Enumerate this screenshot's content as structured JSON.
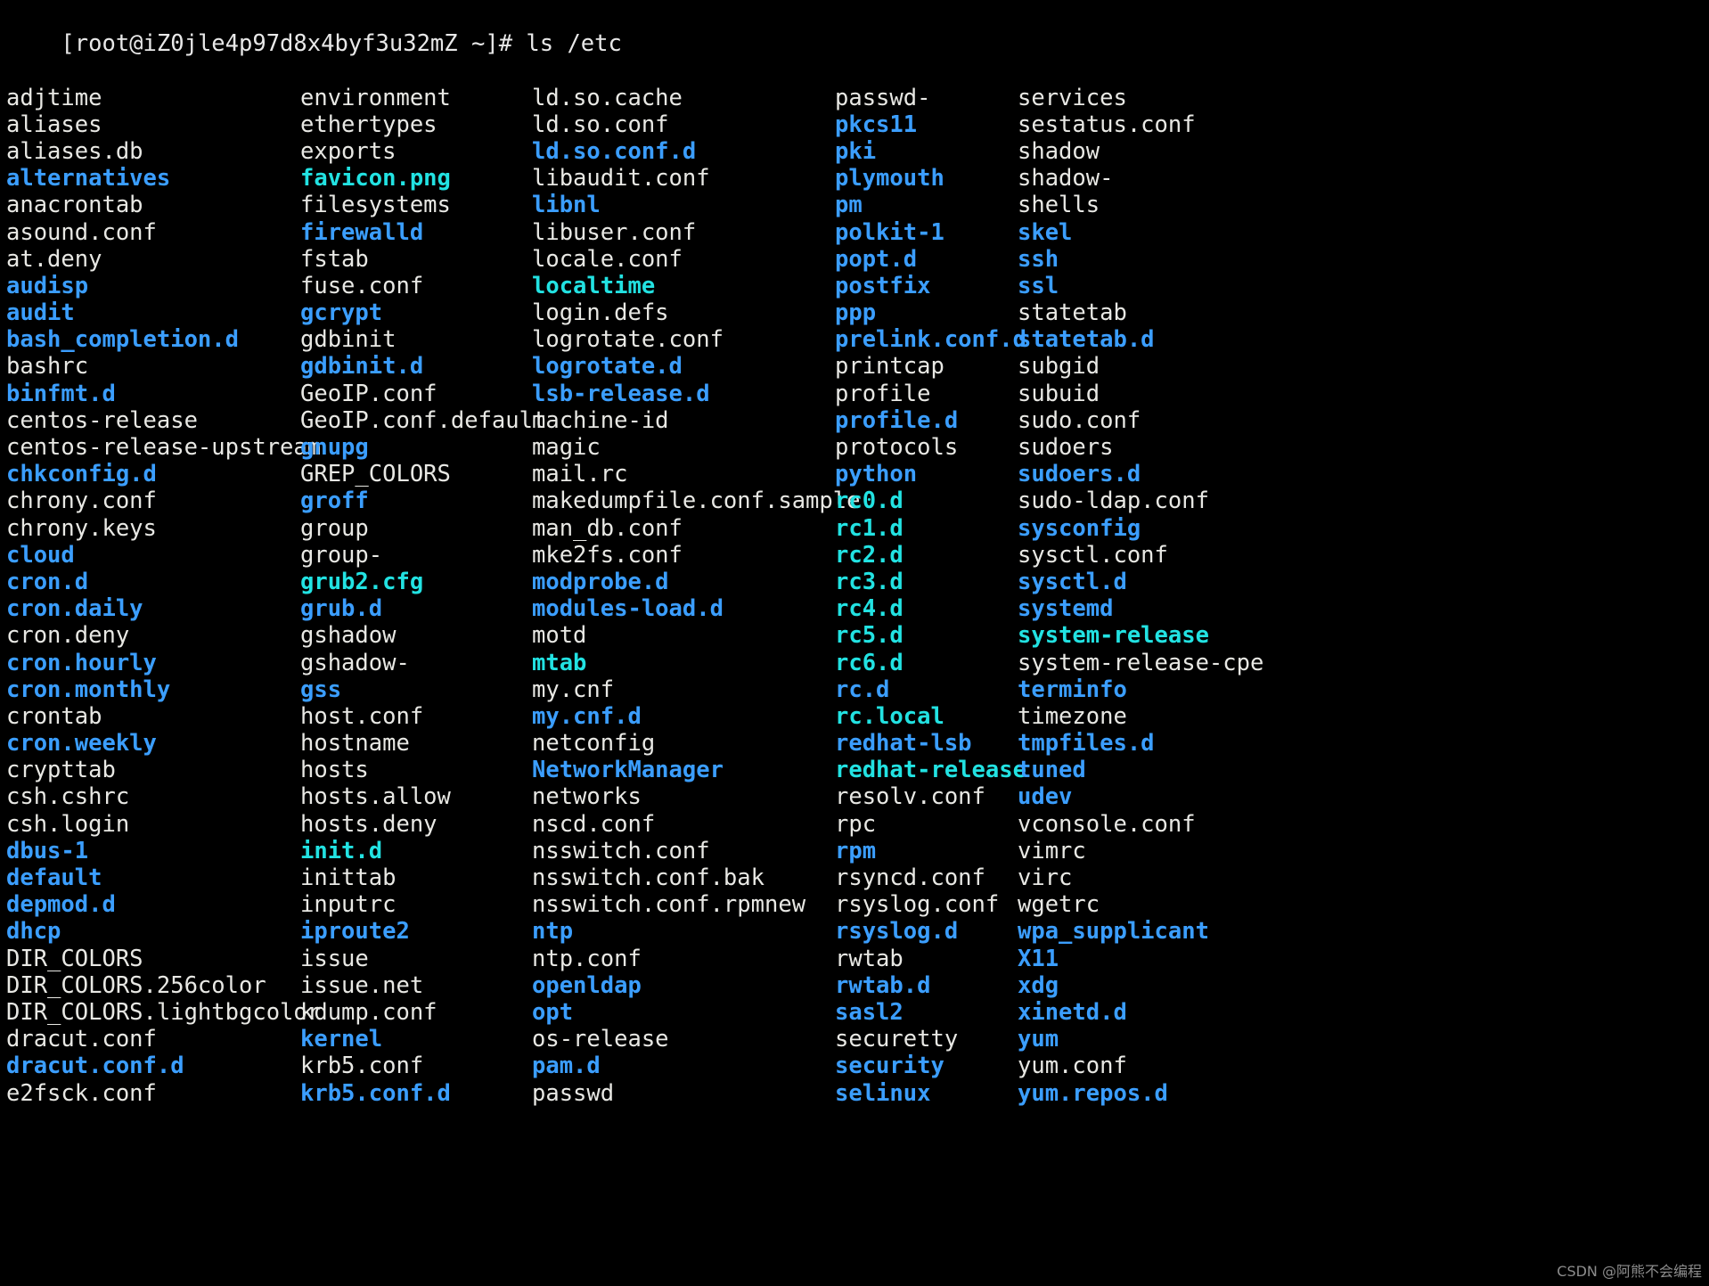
{
  "terminal": {
    "prompt": "[root@iZ0jle4p97d8x4byf3u32mZ ~]# ls /etc",
    "colors": {
      "background": "#000000",
      "file": "#e8e8e4",
      "directory": "#3b9eff",
      "symlink": "#22e2e2",
      "image": "#22e2e2"
    },
    "columns": [
      {
        "name": "column-1",
        "entries": [
          {
            "name": "adjtime",
            "type": "file"
          },
          {
            "name": "aliases",
            "type": "file"
          },
          {
            "name": "aliases.db",
            "type": "file"
          },
          {
            "name": "alternatives",
            "type": "directory"
          },
          {
            "name": "anacrontab",
            "type": "file"
          },
          {
            "name": "asound.conf",
            "type": "file"
          },
          {
            "name": "at.deny",
            "type": "file"
          },
          {
            "name": "audisp",
            "type": "directory"
          },
          {
            "name": "audit",
            "type": "directory"
          },
          {
            "name": "bash_completion.d",
            "type": "directory"
          },
          {
            "name": "bashrc",
            "type": "file"
          },
          {
            "name": "binfmt.d",
            "type": "directory"
          },
          {
            "name": "centos-release",
            "type": "file"
          },
          {
            "name": "centos-release-upstream",
            "type": "file"
          },
          {
            "name": "chkconfig.d",
            "type": "directory"
          },
          {
            "name": "chrony.conf",
            "type": "file"
          },
          {
            "name": "chrony.keys",
            "type": "file"
          },
          {
            "name": "cloud",
            "type": "directory"
          },
          {
            "name": "cron.d",
            "type": "directory"
          },
          {
            "name": "cron.daily",
            "type": "directory"
          },
          {
            "name": "cron.deny",
            "type": "file"
          },
          {
            "name": "cron.hourly",
            "type": "directory"
          },
          {
            "name": "cron.monthly",
            "type": "directory"
          },
          {
            "name": "crontab",
            "type": "file"
          },
          {
            "name": "cron.weekly",
            "type": "directory"
          },
          {
            "name": "crypttab",
            "type": "file"
          },
          {
            "name": "csh.cshrc",
            "type": "file"
          },
          {
            "name": "csh.login",
            "type": "file"
          },
          {
            "name": "dbus-1",
            "type": "directory"
          },
          {
            "name": "default",
            "type": "directory"
          },
          {
            "name": "depmod.d",
            "type": "directory"
          },
          {
            "name": "dhcp",
            "type": "directory"
          },
          {
            "name": "DIR_COLORS",
            "type": "file"
          },
          {
            "name": "DIR_COLORS.256color",
            "type": "file"
          },
          {
            "name": "DIR_COLORS.lightbgcolor",
            "type": "file"
          },
          {
            "name": "dracut.conf",
            "type": "file"
          },
          {
            "name": "dracut.conf.d",
            "type": "directory"
          },
          {
            "name": "e2fsck.conf",
            "type": "file"
          }
        ]
      },
      {
        "name": "column-2",
        "entries": [
          {
            "name": "environment",
            "type": "file"
          },
          {
            "name": "ethertypes",
            "type": "file"
          },
          {
            "name": "exports",
            "type": "file"
          },
          {
            "name": "favicon.png",
            "type": "image"
          },
          {
            "name": "filesystems",
            "type": "file"
          },
          {
            "name": "firewalld",
            "type": "directory"
          },
          {
            "name": "fstab",
            "type": "file"
          },
          {
            "name": "fuse.conf",
            "type": "file"
          },
          {
            "name": "gcrypt",
            "type": "directory"
          },
          {
            "name": "gdbinit",
            "type": "file"
          },
          {
            "name": "gdbinit.d",
            "type": "directory"
          },
          {
            "name": "GeoIP.conf",
            "type": "file"
          },
          {
            "name": "GeoIP.conf.default",
            "type": "file"
          },
          {
            "name": "gnupg",
            "type": "directory"
          },
          {
            "name": "GREP_COLORS",
            "type": "file"
          },
          {
            "name": "groff",
            "type": "directory"
          },
          {
            "name": "group",
            "type": "file"
          },
          {
            "name": "group-",
            "type": "file"
          },
          {
            "name": "grub2.cfg",
            "type": "symlink"
          },
          {
            "name": "grub.d",
            "type": "directory"
          },
          {
            "name": "gshadow",
            "type": "file"
          },
          {
            "name": "gshadow-",
            "type": "file"
          },
          {
            "name": "gss",
            "type": "directory"
          },
          {
            "name": "host.conf",
            "type": "file"
          },
          {
            "name": "hostname",
            "type": "file"
          },
          {
            "name": "hosts",
            "type": "file"
          },
          {
            "name": "hosts.allow",
            "type": "file"
          },
          {
            "name": "hosts.deny",
            "type": "file"
          },
          {
            "name": "init.d",
            "type": "symlink"
          },
          {
            "name": "inittab",
            "type": "file"
          },
          {
            "name": "inputrc",
            "type": "file"
          },
          {
            "name": "iproute2",
            "type": "directory"
          },
          {
            "name": "issue",
            "type": "file"
          },
          {
            "name": "issue.net",
            "type": "file"
          },
          {
            "name": "kdump.conf",
            "type": "file"
          },
          {
            "name": "kernel",
            "type": "directory"
          },
          {
            "name": "krb5.conf",
            "type": "file"
          },
          {
            "name": "krb5.conf.d",
            "type": "directory"
          }
        ]
      },
      {
        "name": "column-3",
        "entries": [
          {
            "name": "ld.so.cache",
            "type": "file"
          },
          {
            "name": "ld.so.conf",
            "type": "file"
          },
          {
            "name": "ld.so.conf.d",
            "type": "directory"
          },
          {
            "name": "libaudit.conf",
            "type": "file"
          },
          {
            "name": "libnl",
            "type": "directory"
          },
          {
            "name": "libuser.conf",
            "type": "file"
          },
          {
            "name": "locale.conf",
            "type": "file"
          },
          {
            "name": "localtime",
            "type": "symlink"
          },
          {
            "name": "login.defs",
            "type": "file"
          },
          {
            "name": "logrotate.conf",
            "type": "file"
          },
          {
            "name": "logrotate.d",
            "type": "directory"
          },
          {
            "name": "lsb-release.d",
            "type": "directory"
          },
          {
            "name": "machine-id",
            "type": "file"
          },
          {
            "name": "magic",
            "type": "file"
          },
          {
            "name": "mail.rc",
            "type": "file"
          },
          {
            "name": "makedumpfile.conf.sample",
            "type": "file"
          },
          {
            "name": "man_db.conf",
            "type": "file"
          },
          {
            "name": "mke2fs.conf",
            "type": "file"
          },
          {
            "name": "modprobe.d",
            "type": "directory"
          },
          {
            "name": "modules-load.d",
            "type": "directory"
          },
          {
            "name": "motd",
            "type": "file"
          },
          {
            "name": "mtab",
            "type": "symlink"
          },
          {
            "name": "my.cnf",
            "type": "file"
          },
          {
            "name": "my.cnf.d",
            "type": "directory"
          },
          {
            "name": "netconfig",
            "type": "file"
          },
          {
            "name": "NetworkManager",
            "type": "directory"
          },
          {
            "name": "networks",
            "type": "file"
          },
          {
            "name": "nscd.conf",
            "type": "file"
          },
          {
            "name": "nsswitch.conf",
            "type": "file"
          },
          {
            "name": "nsswitch.conf.bak",
            "type": "file"
          },
          {
            "name": "nsswitch.conf.rpmnew",
            "type": "file"
          },
          {
            "name": "ntp",
            "type": "directory"
          },
          {
            "name": "ntp.conf",
            "type": "file"
          },
          {
            "name": "openldap",
            "type": "directory"
          },
          {
            "name": "opt",
            "type": "directory"
          },
          {
            "name": "os-release",
            "type": "file"
          },
          {
            "name": "pam.d",
            "type": "directory"
          },
          {
            "name": "passwd",
            "type": "file"
          }
        ]
      },
      {
        "name": "column-4",
        "entries": [
          {
            "name": "passwd-",
            "type": "file"
          },
          {
            "name": "pkcs11",
            "type": "directory"
          },
          {
            "name": "pki",
            "type": "directory"
          },
          {
            "name": "plymouth",
            "type": "directory"
          },
          {
            "name": "pm",
            "type": "directory"
          },
          {
            "name": "polkit-1",
            "type": "directory"
          },
          {
            "name": "popt.d",
            "type": "directory"
          },
          {
            "name": "postfix",
            "type": "directory"
          },
          {
            "name": "ppp",
            "type": "directory"
          },
          {
            "name": "prelink.conf.d",
            "type": "directory"
          },
          {
            "name": "printcap",
            "type": "file"
          },
          {
            "name": "profile",
            "type": "file"
          },
          {
            "name": "profile.d",
            "type": "directory"
          },
          {
            "name": "protocols",
            "type": "file"
          },
          {
            "name": "python",
            "type": "directory"
          },
          {
            "name": "rc0.d",
            "type": "symlink"
          },
          {
            "name": "rc1.d",
            "type": "symlink"
          },
          {
            "name": "rc2.d",
            "type": "symlink"
          },
          {
            "name": "rc3.d",
            "type": "symlink"
          },
          {
            "name": "rc4.d",
            "type": "symlink"
          },
          {
            "name": "rc5.d",
            "type": "symlink"
          },
          {
            "name": "rc6.d",
            "type": "symlink"
          },
          {
            "name": "rc.d",
            "type": "directory"
          },
          {
            "name": "rc.local",
            "type": "symlink"
          },
          {
            "name": "redhat-lsb",
            "type": "directory"
          },
          {
            "name": "redhat-release",
            "type": "symlink"
          },
          {
            "name": "resolv.conf",
            "type": "file"
          },
          {
            "name": "rpc",
            "type": "file"
          },
          {
            "name": "rpm",
            "type": "directory"
          },
          {
            "name": "rsyncd.conf",
            "type": "file"
          },
          {
            "name": "rsyslog.conf",
            "type": "file"
          },
          {
            "name": "rsyslog.d",
            "type": "directory"
          },
          {
            "name": "rwtab",
            "type": "file"
          },
          {
            "name": "rwtab.d",
            "type": "directory"
          },
          {
            "name": "sasl2",
            "type": "directory"
          },
          {
            "name": "securetty",
            "type": "file"
          },
          {
            "name": "security",
            "type": "directory"
          },
          {
            "name": "selinux",
            "type": "directory"
          }
        ]
      },
      {
        "name": "column-5",
        "entries": [
          {
            "name": "services",
            "type": "file"
          },
          {
            "name": "sestatus.conf",
            "type": "file"
          },
          {
            "name": "shadow",
            "type": "file"
          },
          {
            "name": "shadow-",
            "type": "file"
          },
          {
            "name": "shells",
            "type": "file"
          },
          {
            "name": "skel",
            "type": "directory"
          },
          {
            "name": "ssh",
            "type": "directory"
          },
          {
            "name": "ssl",
            "type": "directory"
          },
          {
            "name": "statetab",
            "type": "file"
          },
          {
            "name": "statetab.d",
            "type": "directory"
          },
          {
            "name": "subgid",
            "type": "file"
          },
          {
            "name": "subuid",
            "type": "file"
          },
          {
            "name": "sudo.conf",
            "type": "file"
          },
          {
            "name": "sudoers",
            "type": "file"
          },
          {
            "name": "sudoers.d",
            "type": "directory"
          },
          {
            "name": "sudo-ldap.conf",
            "type": "file"
          },
          {
            "name": "sysconfig",
            "type": "directory"
          },
          {
            "name": "sysctl.conf",
            "type": "file"
          },
          {
            "name": "sysctl.d",
            "type": "directory"
          },
          {
            "name": "systemd",
            "type": "directory"
          },
          {
            "name": "system-release",
            "type": "symlink"
          },
          {
            "name": "system-release-cpe",
            "type": "file"
          },
          {
            "name": "terminfo",
            "type": "directory"
          },
          {
            "name": "timezone",
            "type": "file"
          },
          {
            "name": "tmpfiles.d",
            "type": "directory"
          },
          {
            "name": "tuned",
            "type": "directory"
          },
          {
            "name": "udev",
            "type": "directory"
          },
          {
            "name": "vconsole.conf",
            "type": "file"
          },
          {
            "name": "vimrc",
            "type": "file"
          },
          {
            "name": "virc",
            "type": "file"
          },
          {
            "name": "wgetrc",
            "type": "file"
          },
          {
            "name": "wpa_supplicant",
            "type": "directory"
          },
          {
            "name": "X11",
            "type": "directory"
          },
          {
            "name": "xdg",
            "type": "directory"
          },
          {
            "name": "xinetd.d",
            "type": "directory"
          },
          {
            "name": "yum",
            "type": "directory"
          },
          {
            "name": "yum.conf",
            "type": "file"
          },
          {
            "name": "yum.repos.d",
            "type": "directory"
          }
        ]
      }
    ]
  },
  "watermark": {
    "text": "CSDN @阿熊不会编程"
  }
}
